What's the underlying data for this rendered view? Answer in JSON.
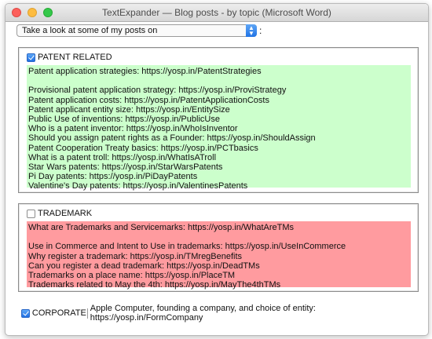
{
  "window": {
    "title": "TextExpander — Blog posts - by topic (Microsoft Word)"
  },
  "dropdown": {
    "selected": "Take a look at some of my posts on",
    "suffix": ":"
  },
  "patent": {
    "label": "PATENT RELATED",
    "checked": true,
    "lines": [
      "Patent application strategies: https://yosp.in/PatentStrategies",
      "",
      "Provisional patent application strategy: https://yosp.in/ProviStrategy",
      "Patent application costs: https://yosp.in/PatentApplicationCosts",
      "Patent applicant entity size: https://yosp.in/EntitySize",
      "Public Use of inventions: https://yosp.in/PublicUse",
      "Who is a patent inventor: https://yosp.in/WhoIsInventor",
      "Should you assign patent rights as a Founder: https://yosp.in/ShouldAssign",
      "Patent Cooperation Treaty basics: https://yosp.in/PCTbasics",
      "What is a patent troll: https://yosp.in/WhatIsATroll",
      "Star Wars patents: https://yosp.in/StarWarsPatents",
      "Pi Day patents: https://yosp.in/PiDayPatents",
      "Valentine's Day patents: https://yosp.in/ValentinesPatents"
    ]
  },
  "trademark": {
    "label": "TRADEMARK",
    "checked": false,
    "lines": [
      "What are Trademarks and Servicemarks: https://yosp.in/WhatAreTMs",
      "",
      "Use in Commerce and Intent to Use in trademarks: https://yosp.in/UseInCommerce",
      "Why register a trademark: https://yosp.in/TMregBenefits",
      "Can you register a dead trademark: https://yosp.in/DeadTMs",
      "Trademarks on a place name: https://yosp.in/PlaceTM",
      "Trademarks related to May the 4th: https://yosp.in/MayThe4thTMs"
    ]
  },
  "corporate": {
    "label": "CORPORATE",
    "checked": true,
    "text": "Apple Computer, founding a company, and choice of entity: https://yosp.in/FormCompany"
  },
  "colors": {
    "patent_bg": "#ccffcc",
    "trademark_bg": "#ff9b9f",
    "accent": "#1f73e6"
  }
}
